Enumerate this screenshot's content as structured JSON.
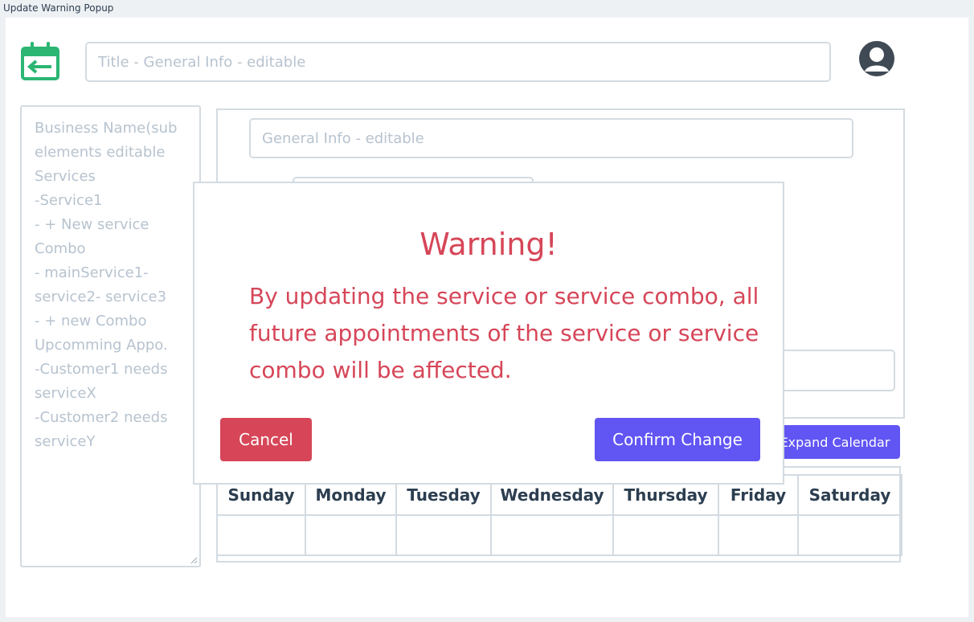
{
  "page_label": "Update Warning Popup",
  "header": {
    "title_placeholder": "Title - General Info - editable"
  },
  "sidebar": {
    "lines": [
      "Business Name(sub",
      "elements editable",
      "Services",
      "-Service1",
      "- + New service",
      "Combo",
      "- mainService1-",
      "service2- service3",
      "- + new Combo",
      "Upcomming Appo.",
      "-Customer1 needs",
      "serviceX",
      "-Customer2 needs",
      "serviceY"
    ]
  },
  "main": {
    "general_placeholder": "General Info - editable",
    "expand_calendar_label": "Expand Calendar"
  },
  "calendar": {
    "days": [
      "Sunday",
      "Monday",
      "Tuesday",
      "Wednesday",
      "Thursday",
      "Friday",
      "Saturday"
    ]
  },
  "modal": {
    "title": "Warning!",
    "message": "By updating the service or service combo, all future appointments of the service or service combo will be affected.",
    "cancel_label": "Cancel",
    "confirm_label": "Confirm Change"
  },
  "colors": {
    "warning": "#d64658",
    "primary": "#6155f3",
    "icon_green": "#2bb673",
    "border": "#d3dbe2",
    "muted_text": "#b7c3cf"
  }
}
